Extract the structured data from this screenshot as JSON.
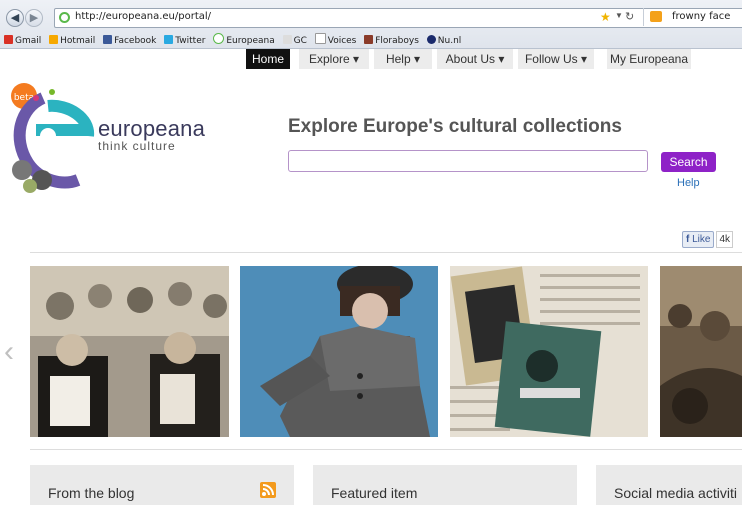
{
  "browser": {
    "url": "http://europeana.eu/portal/",
    "search_text": "frowny face",
    "bookmarks": [
      "Gmail",
      "Hotmail",
      "Facebook",
      "Twitter",
      "Europeana",
      "GC",
      "Voices",
      "Floraboys",
      "Nu.nl"
    ]
  },
  "nav": {
    "items": [
      "Home",
      "Explore ▾",
      "Help ▾",
      "About Us ▾",
      "Follow Us ▾",
      "My Europeana"
    ],
    "active": "Home"
  },
  "logo": {
    "name": "europeana",
    "tagline": "think culture",
    "badge": "beta"
  },
  "hero": {
    "headline": "Explore Europe's cultural collections",
    "search_value": "",
    "search_button": "Search",
    "help": "Help"
  },
  "social": {
    "like_label": "Like",
    "like_count": "4k"
  },
  "carousel": {
    "prev_arrow": "‹"
  },
  "panels": [
    {
      "title": "From the blog"
    },
    {
      "title": "Featured item"
    },
    {
      "title": "Social media activiti"
    }
  ]
}
